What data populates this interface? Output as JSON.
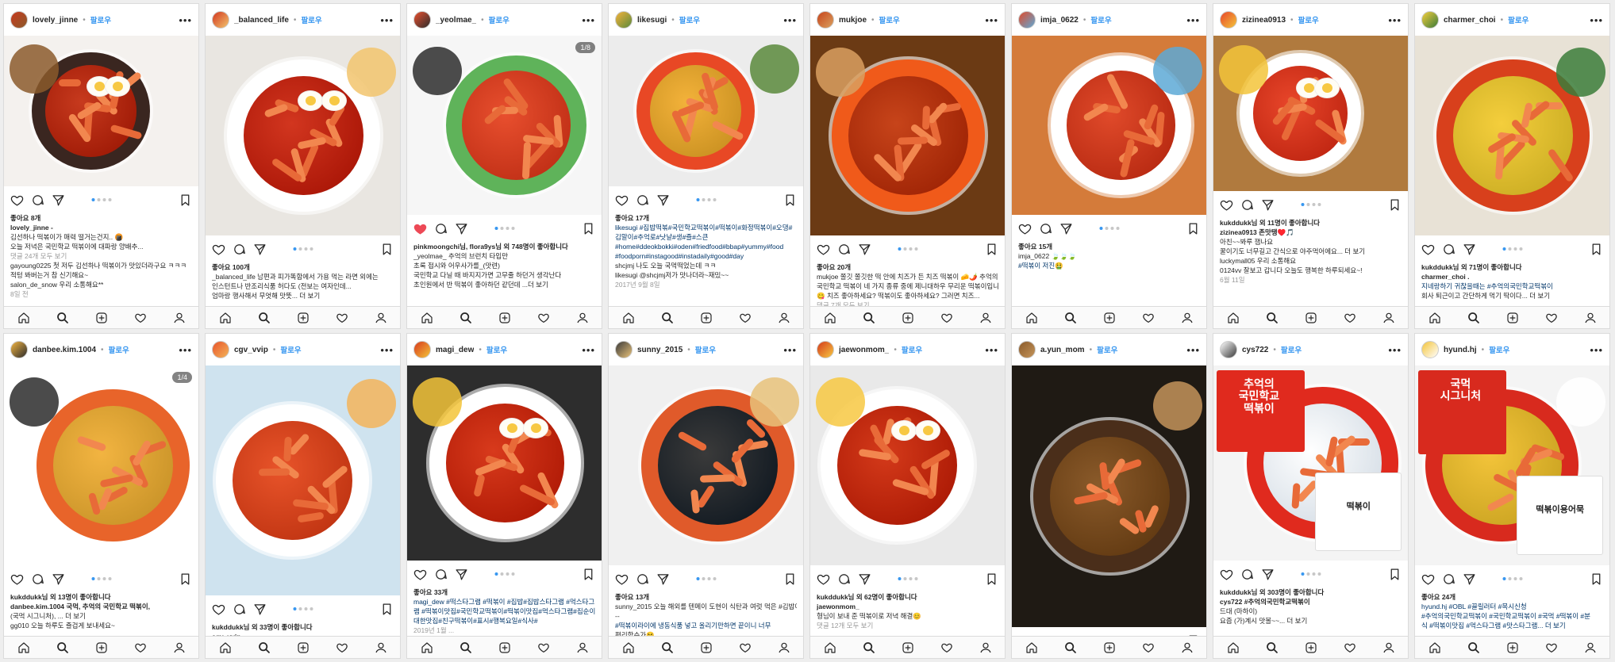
{
  "common": {
    "follow_label": "팔로우",
    "nav_icons": [
      "home-icon",
      "search-icon",
      "add-post-icon",
      "activity-heart-icon",
      "profile-icon"
    ],
    "action_icons": [
      "like-heart-icon",
      "comment-bubble-icon",
      "share-direct-icon",
      "bookmark-icon"
    ]
  },
  "posts": [
    {
      "username": "lovely_jinne",
      "photo_theme": [
        "#f4f1ee",
        "#3a2620",
        "#c73a1e",
        "#8b5a2b"
      ],
      "lines": [
        {
          "t": "좋아요 8개",
          "k": "likes"
        },
        {
          "t": "lovely_jinne -",
          "k": "user"
        },
        {
          "t": "김선하나 떡볶이가 매력 떨거는건지.. 🍘",
          "k": "text"
        },
        {
          "t": "오늘 저녁은 국민학교 떡볶이에 대파랑 양배추...",
          "k": "text"
        },
        {
          "t": "댓글 24개 모두 보기",
          "k": "gray"
        },
        {
          "t": "gayoung0225 첫 저두 김선하나 떡볶이가 맛있더라구요 ㅋㅋㅋ",
          "k": "text"
        },
        {
          "t": "적텅 봐버는거 참 신기해요~",
          "k": "text"
        },
        {
          "t": "salon_de_snow 우리 소통해요**",
          "k": "text"
        },
        {
          "t": "8일 전",
          "k": "gray"
        }
      ]
    },
    {
      "username": "_balanced_life",
      "photo_theme": [
        "#e9e6e1",
        "#ffffff",
        "#d2361f",
        "#f2c46d"
      ],
      "lines": [
        {
          "t": "좋아요 100개",
          "k": "likes"
        },
        {
          "t": "_balanced_life 남편과 피가똑함에서 가용 먹는 라면 외에는",
          "k": "text"
        },
        {
          "t": "인스턴트나 반조리식품 허다도 (전보는 여자인데...",
          "k": "text"
        },
        {
          "t": "엄마랑 행사해서 무엇해 맛뜻... 더 보기",
          "k": "text"
        }
      ]
    },
    {
      "username": "_yeolmae_",
      "photo_theme": [
        "#f6f6f6",
        "#5fb35a",
        "#e84f2e",
        "#2d2d2d"
      ],
      "counter": "1/8",
      "liked": true,
      "lines": [
        {
          "t": "pinkmoongchi님, flora9ys님 외 748명이 좋아합니다",
          "k": "likes"
        },
        {
          "t": "_yeolmae_ 추억의 브런치 타입만",
          "k": "text"
        },
        {
          "t": "초록 접시와 어우사가를_(맛련)",
          "k": "text"
        },
        {
          "t": "국민학교 다닐 때 바지지가면 고무줄 하던거 생각난다",
          "k": "text"
        },
        {
          "t": "초인원에서 반 떡볶이 좋아하던 같던데 ...더 보기",
          "k": "text"
        }
      ]
    },
    {
      "username": "likesugi",
      "photo_theme": [
        "#ececec",
        "#e84825",
        "#f3b23a",
        "#5b8a3c"
      ],
      "lines": [
        {
          "t": "좋아요 17개",
          "k": "likes"
        },
        {
          "t": "likesugi #집밥떡볶#국민학교떡볶이#떡볶이#화정떡볶이#오댕#",
          "k": "tag"
        },
        {
          "t": "김말이#추억로#낫날#생#즐#스큰",
          "k": "tag"
        },
        {
          "t": "#home#ddeokbokki#oden#friedfood#bbap#yummy#food",
          "k": "tag"
        },
        {
          "t": "#foodporn#instagood#instadaily#good#day",
          "k": "tag"
        },
        {
          "t": "shcjmj 나도 오늘 국먹떡었는데 ㅋㅋ",
          "k": "text"
        },
        {
          "t": "likesugi @shcjmj저가 맛나더라~재밌~~",
          "k": "text"
        },
        {
          "t": "2017년 9월 8일",
          "k": "gray"
        }
      ]
    },
    {
      "username": "mukjoe",
      "photo_theme": [
        "#6b3a14",
        "#f05a1a",
        "#c7441a",
        "#d9a060"
      ],
      "lines": [
        {
          "t": "좋아요 20개",
          "k": "likes"
        },
        {
          "t": "mukjoe 쫄깃 쫄깃한 떡 안에 치즈가 든 치즈 떡볶이 🧀🌶️ 추억의",
          "k": "text"
        },
        {
          "t": "국민학교 떡볶이 네 가지 종류 중에 제니대하우 무리운 떡볶이입니다",
          "k": "text"
        },
        {
          "t": "😋 치즈 좋아하세요? 떡볶이도 좋아하세요? 그러면 치즈...",
          "k": "text"
        },
        {
          "t": "댓글 7개 모두 보기",
          "k": "gray"
        }
      ]
    },
    {
      "username": "imja_0622",
      "photo_theme": [
        "#d47b3a",
        "#ffffff",
        "#e04a2a",
        "#5da9d6"
      ],
      "lines": [
        {
          "t": "좋아요 15개",
          "k": "likes"
        },
        {
          "t": "imja_0622 🍃🍃🍃",
          "k": "text"
        },
        {
          "t": "",
          "k": "text"
        },
        {
          "t": "#떡볶이 저진🤮",
          "k": "tag"
        }
      ]
    },
    {
      "username": "zizinea0913",
      "photo_theme": [
        "#b07a3e",
        "#ffffff",
        "#e8462a",
        "#f3c43a"
      ],
      "lines": [
        {
          "t": "kukddukk님 외 11명이 좋아합니다",
          "k": "likes"
        },
        {
          "t": "zizinea0913 존맛탱♥️🎵",
          "k": "user"
        },
        {
          "t": "아친~~봐루 잼나요",
          "k": "text"
        },
        {
          "t": "꿀이기도 너무길고 간식으로 야주먹어에요... 더 보기",
          "k": "text"
        },
        {
          "t": "luckymall05 우리 소통해요",
          "k": "text"
        },
        {
          "t": "0124vv 잘보고 갑니다 오늘도 행복한 하루되세요~!",
          "k": "text"
        },
        {
          "t": "6월 11일",
          "k": "gray"
        }
      ]
    },
    {
      "username": "charmer_choi",
      "photo_theme": [
        "#e8e2d6",
        "#d8401c",
        "#f4ce3c",
        "#3b7c3a"
      ],
      "lines": [
        {
          "t": "kukddukk님 외 71명이 좋아합니다",
          "k": "likes"
        },
        {
          "t": "charmer_choi .",
          "k": "user"
        },
        {
          "t": "지네랑하기 귀찮을때는 #추억의국민학교떡볶이",
          "k": "tag"
        },
        {
          "t": "회사 퇴근이고 간단하게 먹기 딱이다... 더 보기",
          "k": "text"
        }
      ]
    },
    {
      "username": "danbee.kim.1004",
      "photo_theme": [
        "#ffffff",
        "#e8642a",
        "#f2b441",
        "#2b2b2b"
      ],
      "counter": "1/4",
      "lines": [
        {
          "t": "kukddukk님 외 13명이 좋아합니다",
          "k": "likes"
        },
        {
          "t": "danbee.kim.1004 국먹, 추억의 국민학교 떡볶이,",
          "k": "user"
        },
        {
          "t": "(국먹 시그니처), ... 더 보기",
          "k": "text"
        },
        {
          "t": "gg010 오늘 하루도 즐겁게 보내세요~",
          "k": "text"
        }
      ]
    },
    {
      "username": "cgv_vvip",
      "photo_theme": [
        "#cfe3ef",
        "#ffffff",
        "#e8542a",
        "#f3b45a"
      ],
      "lines": [
        {
          "t": "kukddukk님 외 33명이 좋아합니다",
          "k": "likes"
        },
        {
          "t": "cgv_vvip",
          "k": "user"
        }
      ]
    },
    {
      "username": "magi_dew",
      "photo_theme": [
        "#2d2d2d",
        "#ffffff",
        "#d83a1c",
        "#f3c43a"
      ],
      "lines": [
        {
          "t": "좋아요 33개",
          "k": "likes"
        },
        {
          "t": "magi_dew #떡스타그램 #떡볶이 #집밥#집밥스타그램 #먹스타그",
          "k": "tag"
        },
        {
          "t": "램 #떡볶이맛집#국민학교떡볶이#떡볶이맛집#먹스타그램#집순이#",
          "k": "tag"
        },
        {
          "t": "대한맛집#친구떡볶이#표시#행복요일#식사#",
          "k": "tag"
        },
        {
          "t": "2019년 1월 ...",
          "k": "gray"
        }
      ]
    },
    {
      "username": "sunny_2015",
      "photo_theme": [
        "#f0f0f0",
        "#e05a2a",
        "#3a3a3a",
        "#e8c27a"
      ],
      "lines": [
        {
          "t": "좋아요 13개",
          "k": "likes"
        },
        {
          "t": "sunny_2015 오늘 해외를 텐메이 도현이 식탄과 여럿 먹은 #김밥어 세트",
          "k": "text"
        },
        {
          "t": "--",
          "k": "text"
        },
        {
          "t": "#떡볶이라이에 냉동식품 넣고 올리기만하면 끝이니 너무",
          "k": "tag"
        },
        {
          "t": "편리함수가😆",
          "k": "text"
        }
      ]
    },
    {
      "username": "jaewonmom_",
      "photo_theme": [
        "#e9e9e9",
        "#ffffff",
        "#d43a1a",
        "#f7c842"
      ],
      "lines": [
        {
          "t": "kukddukk님 외 62명이 좋아합니다",
          "k": "likes"
        },
        {
          "t": "jaewonmom_",
          "k": "user"
        },
        {
          "t": "형님이 보내 준 떡볶이로 저녁 해결😊",
          "k": "text"
        },
        {
          "t": "댓글 12개 모두 보기",
          "k": "gray"
        }
      ]
    },
    {
      "username": "a.yun_mom",
      "photo_theme": [
        "#1f1a14",
        "#4a2e1a",
        "#8a5a2a",
        "#c4945a"
      ],
      "lines": []
    },
    {
      "username": "cys722",
      "photo_theme": [
        "#f4f4f4",
        "#e02a1e",
        "#ffffff",
        "#3a3a3a"
      ],
      "package_text": [
        "추억의",
        "국민학교",
        "떡볶이"
      ],
      "package_text2": "떡볶이",
      "lines": [
        {
          "t": "kukddukk님 외 303명이 좋아합니다",
          "k": "likes"
        },
        {
          "t": "cys722 #추억의국민학교떡볶이",
          "k": "user"
        },
        {
          "t": "드대 (마하이)",
          "k": "text"
        },
        {
          "t": "요즘 (가)계시 맛볼~~... 더 보기",
          "k": "text"
        }
      ]
    },
    {
      "username": "hyund.hj",
      "photo_theme": [
        "#f4f4f4",
        "#d82a1e",
        "#f3c43a",
        "#ffffff"
      ],
      "package_text": [
        "국먹",
        "시그니처"
      ],
      "package_text2": "떡볶이용어묵",
      "lines": [
        {
          "t": "좋아요 24개",
          "k": "likes"
        },
        {
          "t": "hyund.hj #OBL #끌릴러터 #목시신청",
          "k": "tag"
        },
        {
          "t": "#추억의국민학교떡볶이 #국민학교떡볶이 #국먹 #떡볶이 #분",
          "k": "tag"
        },
        {
          "t": "식 #떡볶이맛집 #먹스타그램 #맛스타그램... 더 보기",
          "k": "tag"
        }
      ]
    }
  ]
}
